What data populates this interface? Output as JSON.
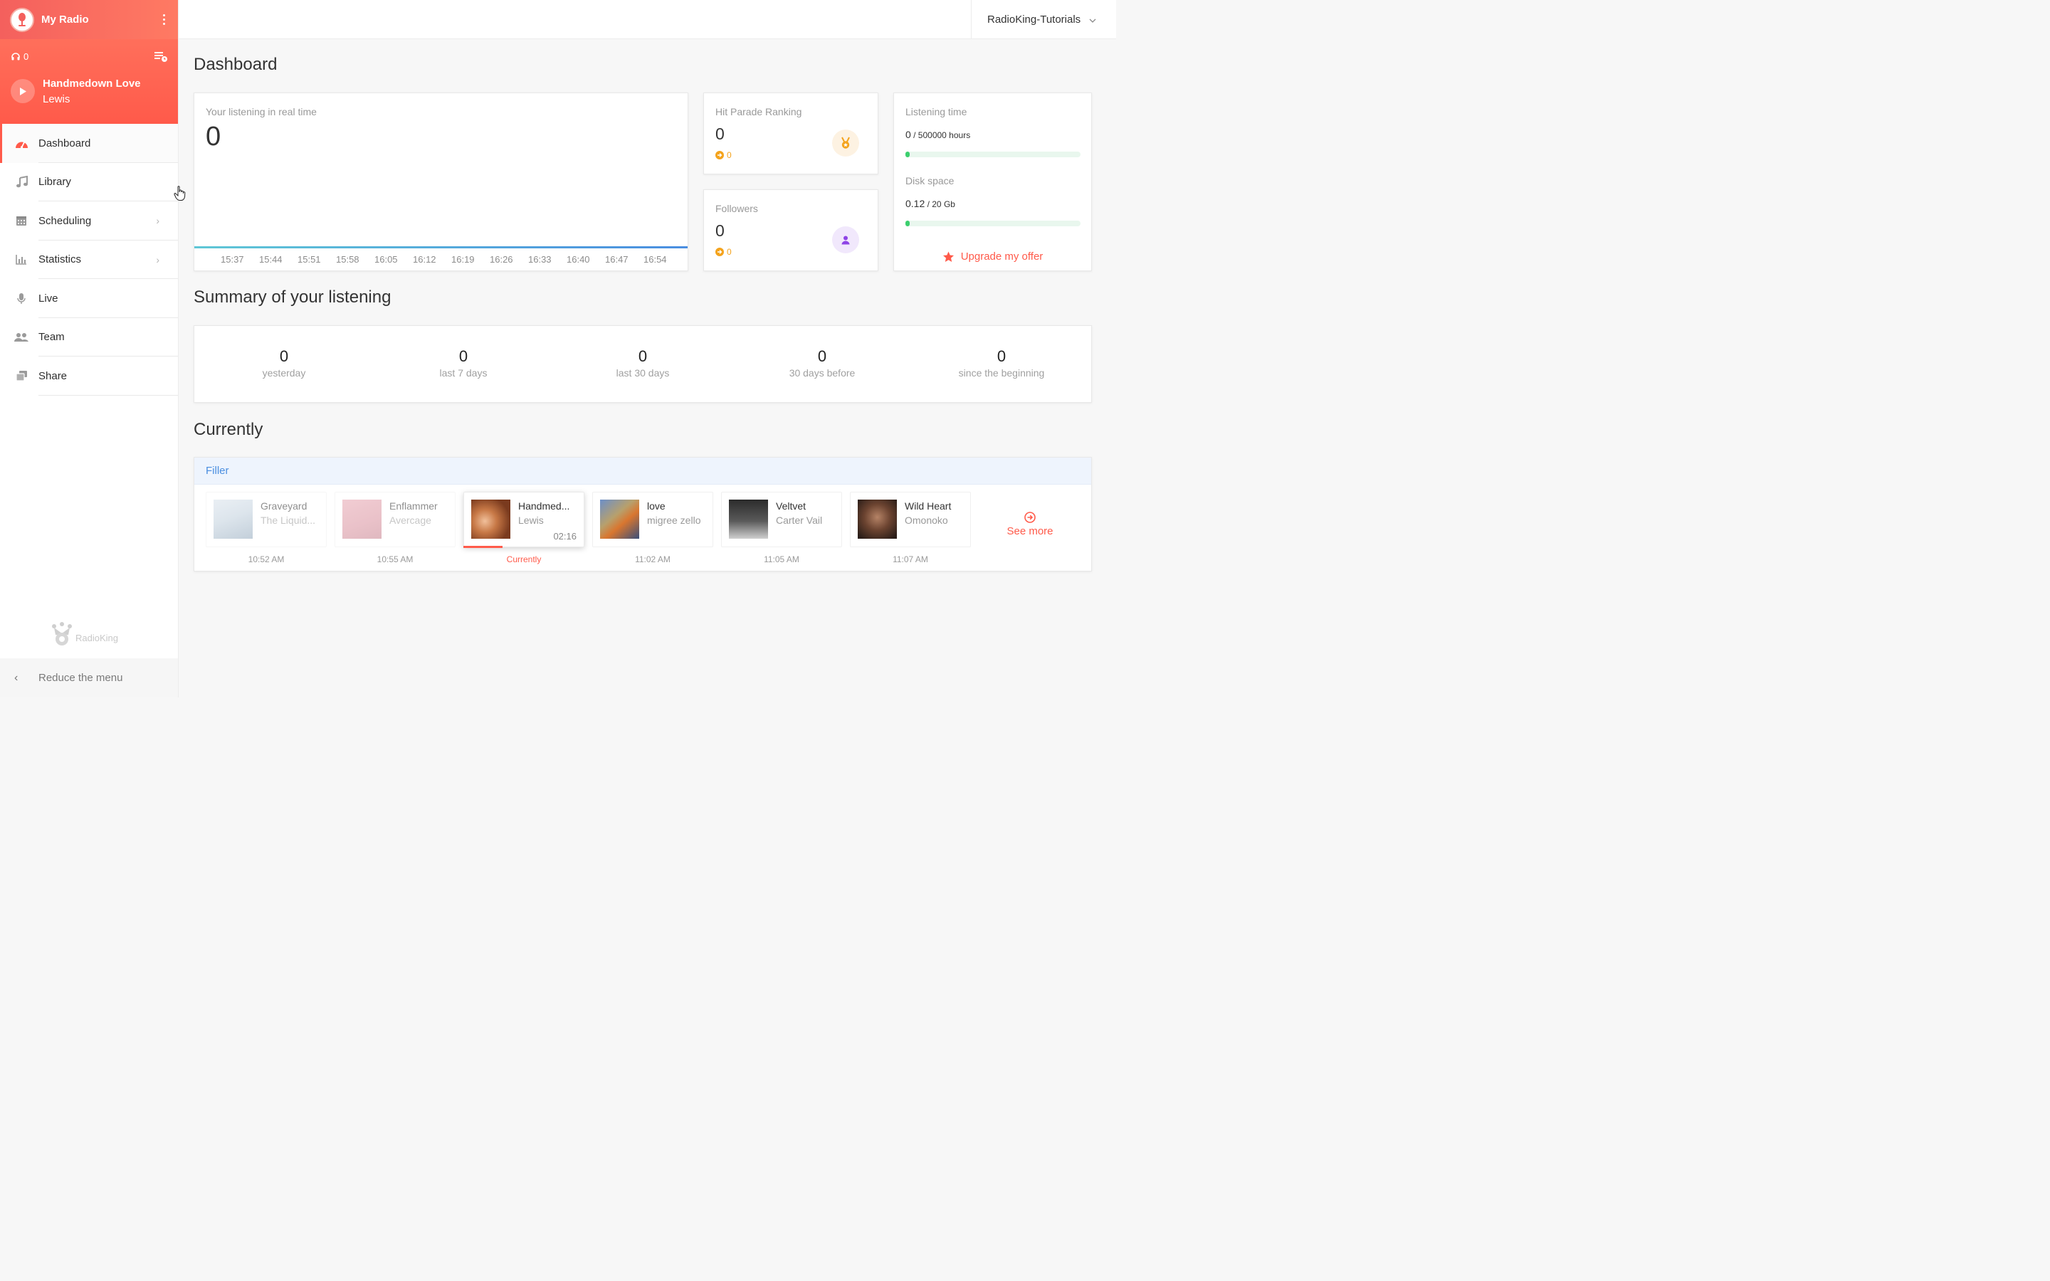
{
  "radio": {
    "name": "My Radio"
  },
  "player": {
    "listeners": "0",
    "track_title": "Handmedown Love",
    "track_artist": "Lewis"
  },
  "nav": [
    {
      "label": "Dashboard",
      "icon": "dashboard-gauge-icon",
      "active": true
    },
    {
      "label": "Library",
      "icon": "music-note-icon"
    },
    {
      "label": "Scheduling",
      "icon": "calendar-icon",
      "has_submenu": true
    },
    {
      "label": "Statistics",
      "icon": "bar-chart-icon",
      "has_submenu": true
    },
    {
      "label": "Live",
      "icon": "microphone-icon"
    },
    {
      "label": "Team",
      "icon": "users-icon"
    },
    {
      "label": "Share",
      "icon": "share-icon"
    }
  ],
  "footer": {
    "brand": "RadioKing",
    "reduce_label": "Reduce the menu"
  },
  "account": {
    "name": "RadioKing-Tutorials"
  },
  "dashboard": {
    "title": "Dashboard",
    "realtime": {
      "label": "Your listening in real time",
      "value": "0",
      "times": [
        "15:37",
        "15:44",
        "15:51",
        "15:58",
        "16:05",
        "16:12",
        "16:19",
        "16:26",
        "16:33",
        "16:40",
        "16:47",
        "16:54"
      ]
    },
    "hit_parade": {
      "label": "Hit Parade Ranking",
      "value": "0",
      "delta": "0"
    },
    "followers": {
      "label": "Followers",
      "value": "0",
      "delta": "0"
    },
    "listening_time": {
      "label": "Listening time",
      "value": "0",
      "total": "/ 500000 hours",
      "fill_percent": 0
    },
    "disk_space": {
      "label": "Disk space",
      "value": "0.12",
      "total": "/ 20 Gb",
      "fill_percent": 0.6
    },
    "upgrade_label": "Upgrade my offer"
  },
  "summary": {
    "title": "Summary of your listening",
    "items": [
      {
        "value": "0",
        "label": "yesterday"
      },
      {
        "value": "0",
        "label": "last 7 days"
      },
      {
        "value": "0",
        "label": "last 30 days"
      },
      {
        "value": "0",
        "label": "30 days before"
      },
      {
        "value": "0",
        "label": "since the beginning"
      }
    ]
  },
  "currently": {
    "title": "Currently",
    "playlist": "Filler",
    "tracks": [
      {
        "title": "Graveyard",
        "artist": "The Liquid...",
        "time": "10:52 AM",
        "state": "past"
      },
      {
        "title": "Enflammer",
        "artist": "Avercage",
        "time": "10:55 AM",
        "state": "past"
      },
      {
        "title": "Handmed...",
        "artist": "Lewis",
        "time": "Currently",
        "duration": "02:16",
        "state": "current",
        "progress_percent": 33
      },
      {
        "title": "love",
        "artist": "migree zello",
        "time": "11:02 AM",
        "state": "upcoming"
      },
      {
        "title": "Veltvet",
        "artist": "Carter Vail",
        "time": "11:05 AM",
        "state": "upcoming"
      },
      {
        "title": "Wild Heart",
        "artist": "Omonoko",
        "time": "11:07 AM",
        "state": "upcoming"
      }
    ],
    "see_more_label": "See more"
  },
  "colors": {
    "accent": "#ff5a4a",
    "info": "#4a8ee0",
    "gold": "#f4a31c",
    "purple": "#8e44e6",
    "green": "#3ccf6e"
  }
}
